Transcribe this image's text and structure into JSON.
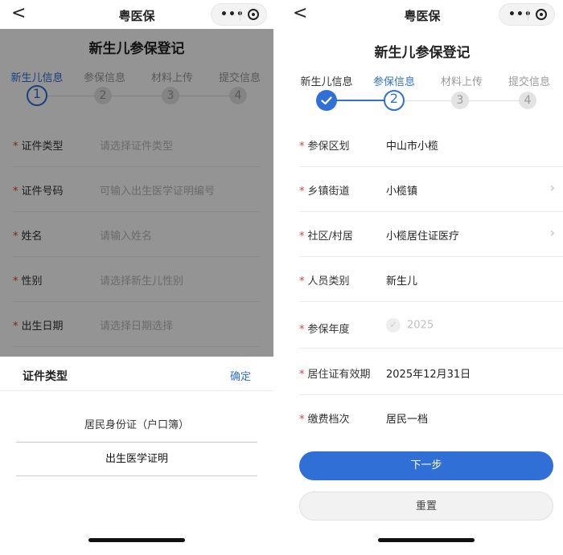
{
  "nav": {
    "back_glyph": "<",
    "title": "粤医保",
    "more_glyph": "•••"
  },
  "page_title": "新生儿参保登记",
  "steps": [
    {
      "label": "新生儿信息",
      "num": "1"
    },
    {
      "label": "参保信息",
      "num": "2"
    },
    {
      "label": "材料上传",
      "num": "3"
    },
    {
      "label": "提交信息",
      "num": "4"
    }
  ],
  "left": {
    "fields": [
      {
        "label": "证件类型",
        "placeholder": "请选择证件类型"
      },
      {
        "label": "证件号码",
        "placeholder": "可输入出生医学证明编号"
      },
      {
        "label": "姓名",
        "placeholder": "请输入姓名"
      },
      {
        "label": "性别",
        "placeholder": "请选择新生儿性别"
      },
      {
        "label": "出生日期",
        "placeholder": "请选择日期选择"
      }
    ],
    "sheet": {
      "title": "证件类型",
      "confirm": "确定",
      "options": [
        "居民身份证（户口簿）",
        "出生医学证明"
      ]
    }
  },
  "right": {
    "fields": [
      {
        "label": "参保区划",
        "value": "中山市小榄"
      },
      {
        "label": "乡镇街道",
        "value": "小榄镇"
      },
      {
        "label": "社区/村居",
        "value": "小榄居住证医疗"
      },
      {
        "label": "人员类别",
        "value": "新生儿"
      },
      {
        "label": "参保年度",
        "value": "2025"
      },
      {
        "label": "居住证有效期",
        "value": "2025年12月31日"
      },
      {
        "label": "缴费档次",
        "value": "居民一档"
      }
    ],
    "next_button": "下一步",
    "reset_button": "重置"
  },
  "colors": {
    "primary": "#2f6fd6",
    "required": "#e53935"
  },
  "icons": [
    "back-arrow-icon",
    "more-dots-icon",
    "target-close-icon",
    "check-icon",
    "chevron-right-icon"
  ]
}
